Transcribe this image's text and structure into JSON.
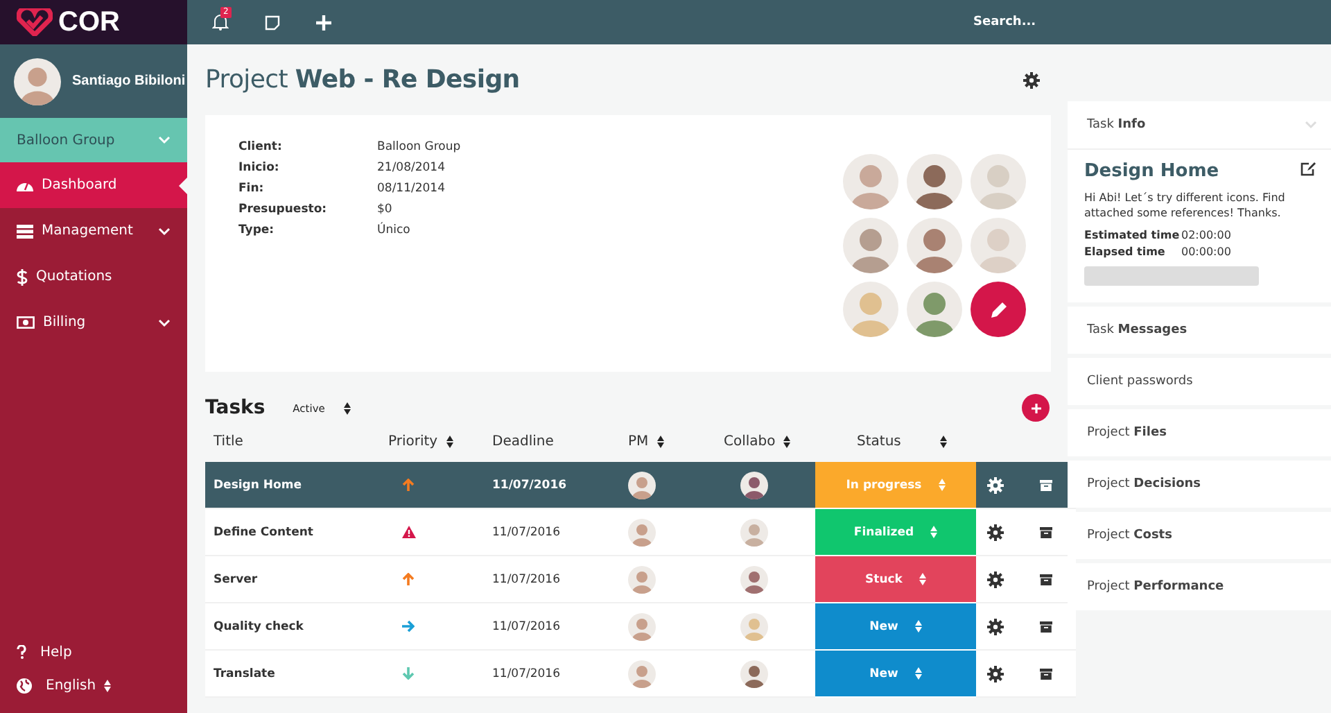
{
  "brand": {
    "name": "COR"
  },
  "topbar": {
    "notifications": "2",
    "search_placeholder": "Search..."
  },
  "user": {
    "name": "Santiago Bibiloni"
  },
  "group": {
    "label": "Balloon Group"
  },
  "nav": [
    {
      "label": "Dashboard",
      "selected": true,
      "submenu": false
    },
    {
      "label": "Management",
      "selected": false,
      "submenu": true
    },
    {
      "label": "Quotations",
      "selected": false,
      "submenu": false
    },
    {
      "label": "Billing",
      "selected": false,
      "submenu": true
    }
  ],
  "sidebar_footer": [
    {
      "label": "Help"
    },
    {
      "label": "English"
    }
  ],
  "page_title": "Project **Web - Re Design**",
  "project": [
    {
      "label": "Client:",
      "value": "Balloon Group"
    },
    {
      "label": "Inicio:",
      "value": "21/08/2014"
    },
    {
      "label": "Fin:",
      "value": "08/11/2014"
    },
    {
      "label": "Presupuesto:",
      "value": "$0"
    },
    {
      "label": "Type:",
      "value": "Único"
    }
  ],
  "tasks": {
    "title": "Tasks",
    "filter": "Active",
    "columns": [
      "Title",
      "Priority",
      "Deadline",
      "PM",
      "Collabo"
    ],
    "status_column": "Status",
    "rows": [
      {
        "title": "Design Home",
        "kind": "up",
        "deadline": "11/07/2016",
        "status": "In progress",
        "color": "#fba92b",
        "selected": true
      },
      {
        "title": "Define Content",
        "kind": "alert",
        "deadline": "11/07/2016",
        "status": "Finalized",
        "color": "#10c66e",
        "selected": false
      },
      {
        "title": "Server",
        "kind": "up",
        "deadline": "11/07/2016",
        "status": "Stuck",
        "color": "#e2445c",
        "selected": false
      },
      {
        "title": "Quality check",
        "kind": "right",
        "deadline": "11/07/2016",
        "status": "New",
        "color": "#0f8ccc",
        "selected": false
      },
      {
        "title": "Translate",
        "kind": "down",
        "deadline": "11/07/2016",
        "status": "New",
        "color": "#0f8ccc",
        "selected": false
      }
    ]
  },
  "right_panel": {
    "task_info": "Task **Info**",
    "task_name": "Design Home",
    "description": "Hi Abi! Let´s try different icons. Find attached some references! Thanks.",
    "times": [
      {
        "label": "Estimated time",
        "value": "02:00:00"
      },
      {
        "label": "Elapsed time",
        "value": "00:00:00"
      }
    ],
    "level": 0,
    "sections": [
      "Task **Messages**",
      "Client passwords",
      "Project **Files**",
      "Project **Decisions**",
      "Project **Costs**",
      "Project **Performance**"
    ]
  }
}
